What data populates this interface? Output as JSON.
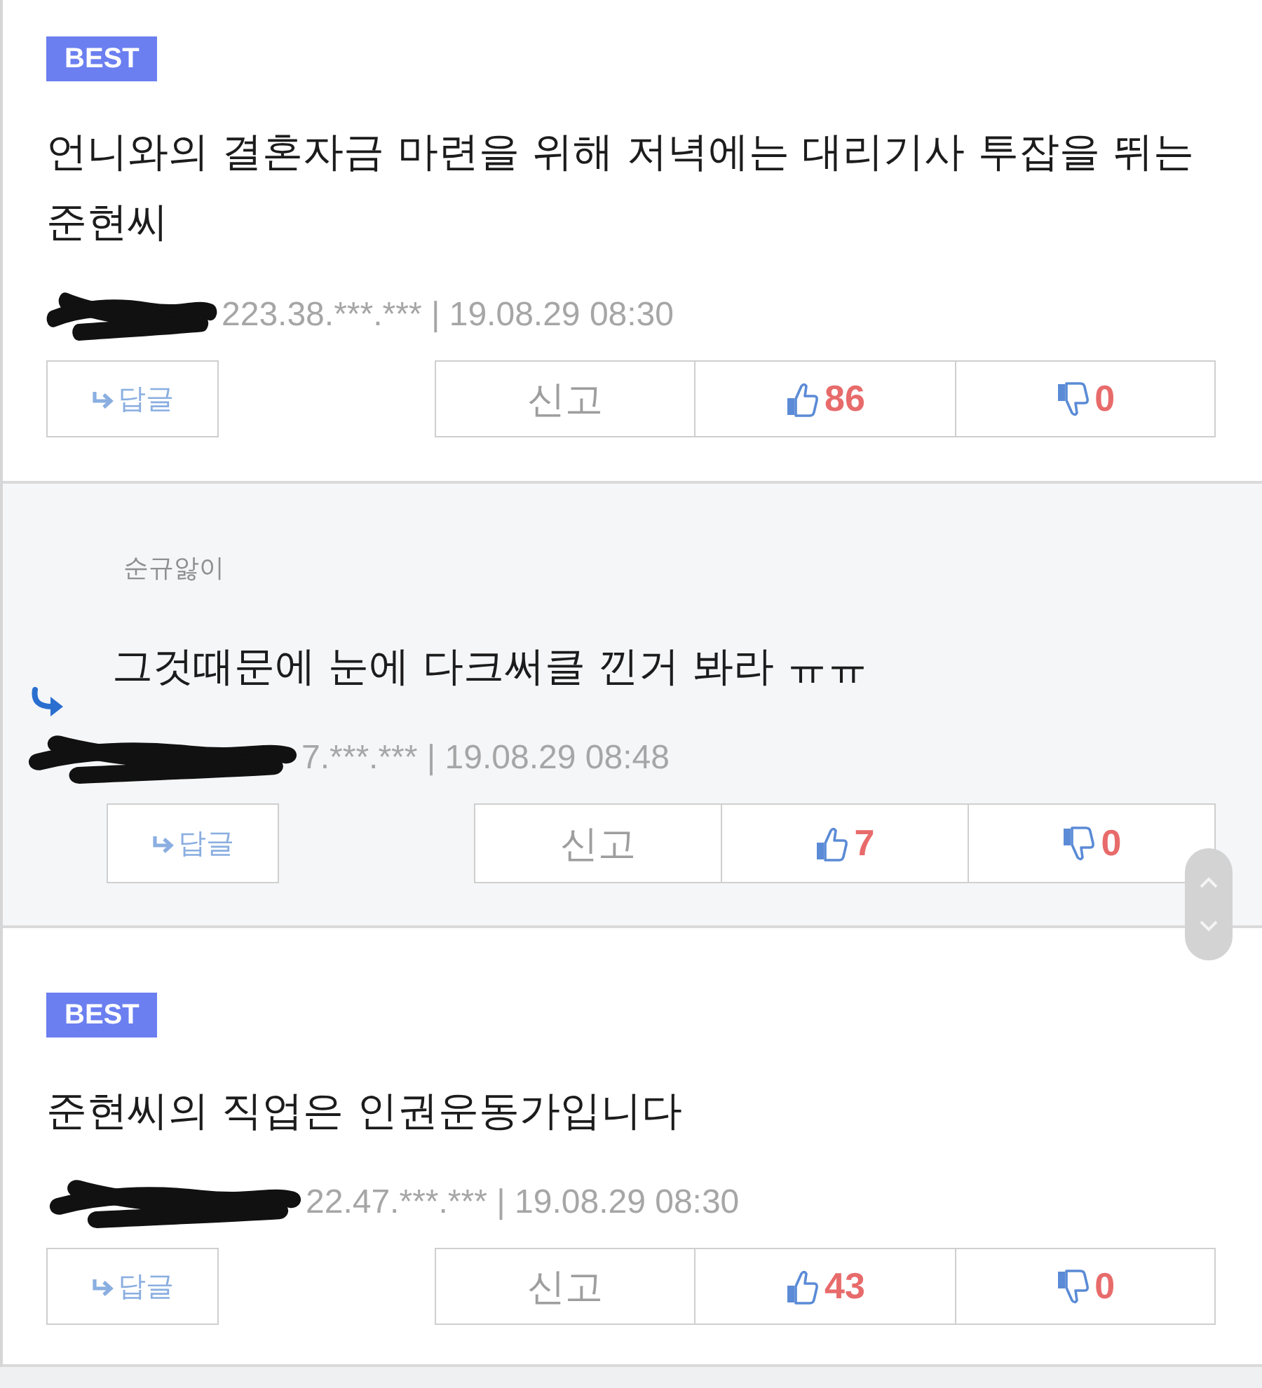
{
  "comments": [
    {
      "kind": "best",
      "badge": "BEST",
      "text": "언니와의 결혼자금 마련을 위해 저녁에는 대리기사 투잡을 뛰는 준현씨",
      "author_redacted": true,
      "meta": "223.38.***.*** | 19.08.29 08:30",
      "reply_label": "답글",
      "report_label": "신고",
      "likes": "86",
      "dislikes": "0"
    },
    {
      "kind": "reply",
      "nickname": "순규앓이",
      "text": "그것때문에 눈에 다크써클 낀거 봐라 ㅠㅠ",
      "author_redacted": true,
      "meta": "7.***.*** | 19.08.29 08:48",
      "reply_label": "답글",
      "report_label": "신고",
      "likes": "7",
      "dislikes": "0"
    },
    {
      "kind": "best",
      "badge": "BEST",
      "text": "준현씨의 직업은 인권운동가입니다",
      "author_redacted": true,
      "meta": "22.47.***.*** | 19.08.29 08:30",
      "reply_label": "답글",
      "report_label": "신고",
      "likes": "43",
      "dislikes": "0"
    }
  ]
}
